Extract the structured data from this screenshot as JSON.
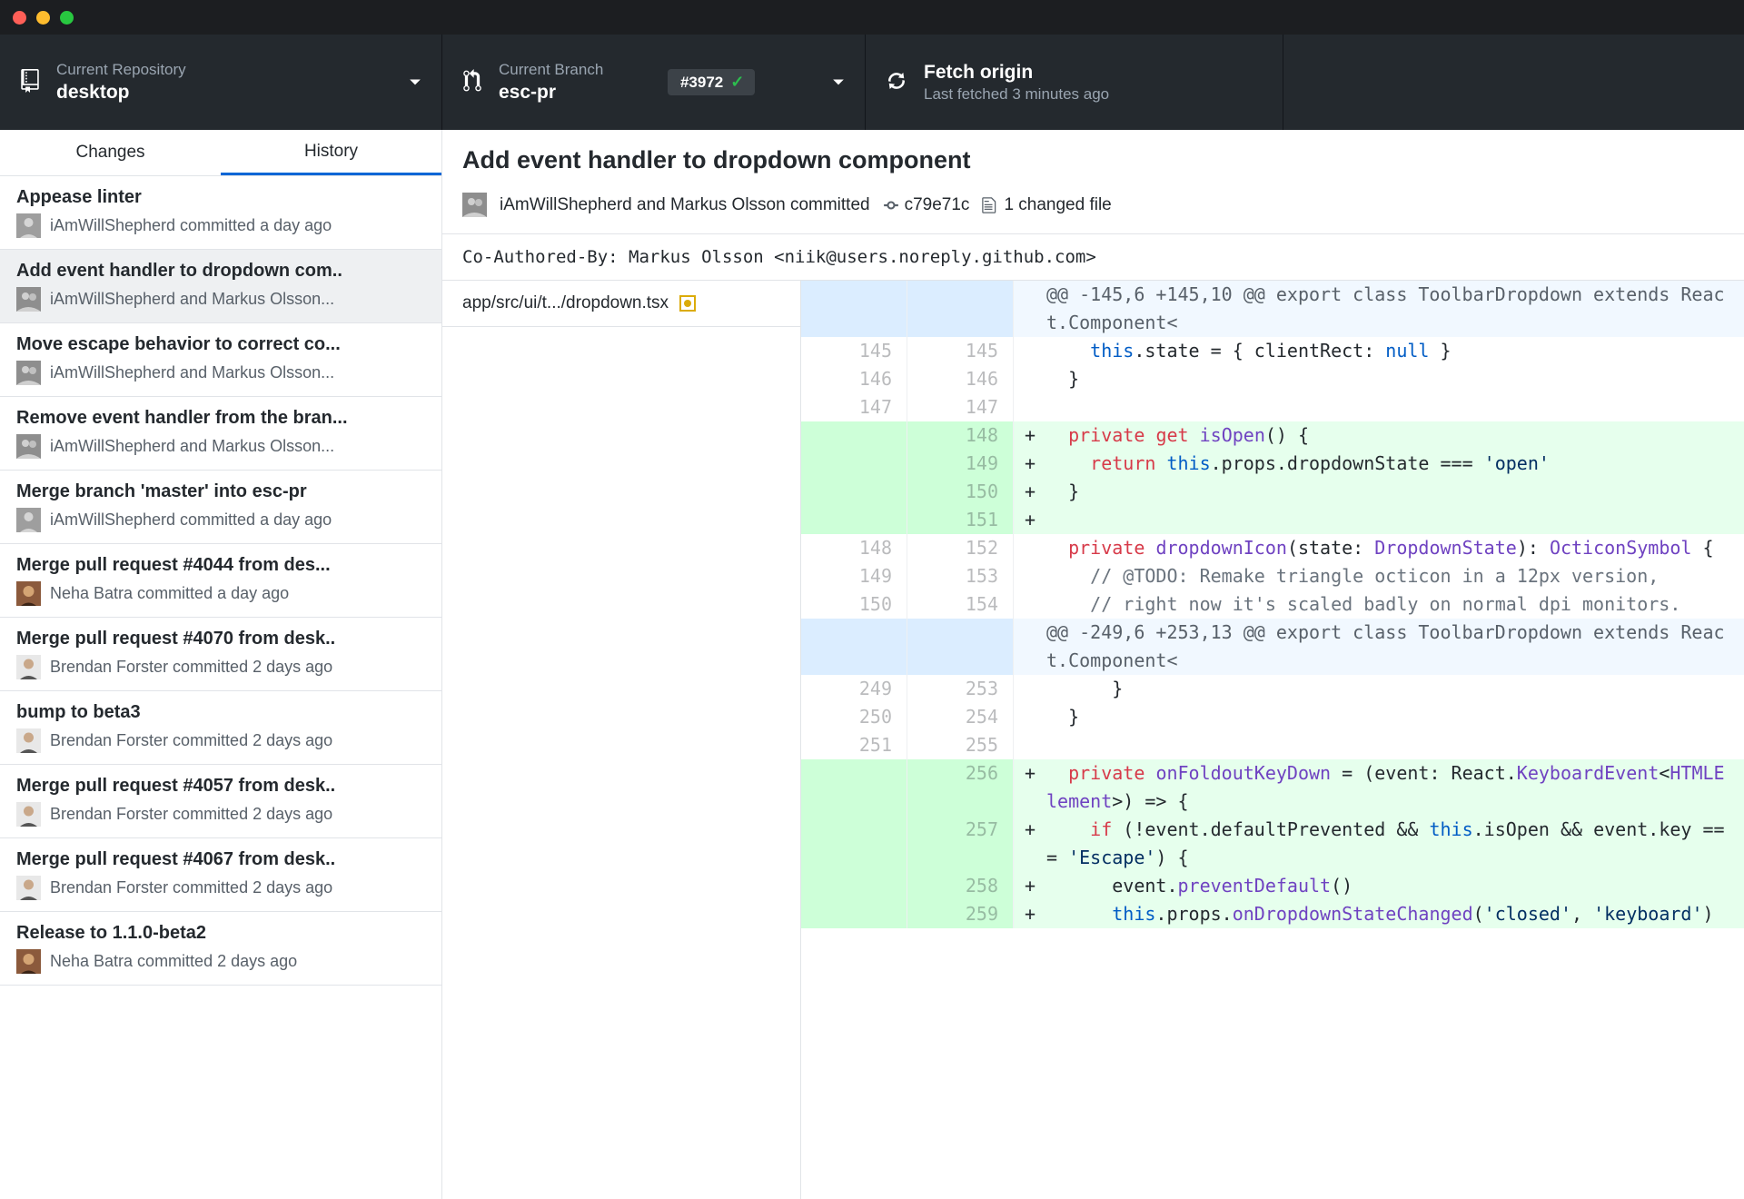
{
  "toolbar": {
    "repo": {
      "label": "Current Repository",
      "value": "desktop"
    },
    "branch": {
      "label": "Current Branch",
      "value": "esc-pr",
      "pr_number": "#3972"
    },
    "fetch": {
      "label": "Fetch origin",
      "sub": "Last fetched 3 minutes ago"
    }
  },
  "tabs": {
    "changes": "Changes",
    "history": "History"
  },
  "commits": [
    {
      "title": "Appease linter",
      "author": "iAmWillShepherd committed a day ago",
      "avatar": "will",
      "selected": false
    },
    {
      "title": "Add event handler to dropdown com..",
      "author": "iAmWillShepherd and Markus Olsson...",
      "avatar": "pair",
      "selected": true
    },
    {
      "title": "Move escape behavior to correct co...",
      "author": "iAmWillShepherd and Markus Olsson...",
      "avatar": "pair",
      "selected": false
    },
    {
      "title": "Remove event handler from the bran...",
      "author": "iAmWillShepherd and Markus Olsson...",
      "avatar": "pair",
      "selected": false
    },
    {
      "title": "Merge branch 'master' into esc-pr",
      "author": "iAmWillShepherd committed a day ago",
      "avatar": "will",
      "selected": false
    },
    {
      "title": "Merge pull request #4044 from des...",
      "author": "Neha Batra committed a day ago",
      "avatar": "neha",
      "selected": false
    },
    {
      "title": "Merge pull request #4070 from desk..",
      "author": "Brendan Forster committed 2 days ago",
      "avatar": "brendan",
      "selected": false
    },
    {
      "title": "bump to beta3",
      "author": "Brendan Forster committed 2 days ago",
      "avatar": "brendan",
      "selected": false
    },
    {
      "title": "Merge pull request #4057 from desk..",
      "author": "Brendan Forster committed 2 days ago",
      "avatar": "brendan",
      "selected": false
    },
    {
      "title": "Merge pull request #4067 from desk..",
      "author": "Brendan Forster committed 2 days ago",
      "avatar": "brendan",
      "selected": false
    },
    {
      "title": "Release to 1.1.0-beta2",
      "author": "Neha Batra committed 2 days ago",
      "avatar": "neha",
      "selected": false
    }
  ],
  "commit_detail": {
    "title": "Add event handler to dropdown component",
    "authors": "iAmWillShepherd and Markus Olsson committed",
    "hash": "c79e71c",
    "files_changed": "1 changed file",
    "description": "Co-Authored-By: Markus Olsson <niik@users.noreply.github.com>",
    "file_path": "app/src/ui/t.../dropdown.tsx"
  },
  "diff": [
    {
      "type": "hunk",
      "old": "",
      "new": "",
      "sign": "",
      "tokens": [
        [
          "",
          "@@ -145,6 +145,10 @@ export class ToolbarDropdown extends React.Component<"
        ]
      ]
    },
    {
      "type": "context",
      "old": "145",
      "new": "145",
      "sign": "",
      "tokens": [
        [
          "",
          "    "
        ],
        [
          "this",
          "this"
        ],
        [
          "",
          ".state = { clientRect: "
        ],
        [
          "null",
          "null"
        ],
        [
          "",
          " }"
        ]
      ]
    },
    {
      "type": "context",
      "old": "146",
      "new": "146",
      "sign": "",
      "tokens": [
        [
          "",
          "  }"
        ]
      ]
    },
    {
      "type": "context",
      "old": "147",
      "new": "147",
      "sign": "",
      "tokens": [
        [
          "",
          ""
        ]
      ]
    },
    {
      "type": "add",
      "old": "",
      "new": "148",
      "sign": "+",
      "tokens": [
        [
          "",
          "  "
        ],
        [
          "kw",
          "private"
        ],
        [
          "",
          " "
        ],
        [
          "kw",
          "get"
        ],
        [
          "",
          " "
        ],
        [
          "fn",
          "isOpen"
        ],
        [
          "",
          "() {"
        ]
      ]
    },
    {
      "type": "add",
      "old": "",
      "new": "149",
      "sign": "+",
      "tokens": [
        [
          "",
          "    "
        ],
        [
          "kw",
          "return"
        ],
        [
          "",
          " "
        ],
        [
          "this",
          "this"
        ],
        [
          "",
          ".props.dropdownState === "
        ],
        [
          "str",
          "'open'"
        ]
      ]
    },
    {
      "type": "add",
      "old": "",
      "new": "150",
      "sign": "+",
      "tokens": [
        [
          "",
          "  }"
        ]
      ]
    },
    {
      "type": "add",
      "old": "",
      "new": "151",
      "sign": "+",
      "tokens": [
        [
          "",
          ""
        ]
      ]
    },
    {
      "type": "context",
      "old": "148",
      "new": "152",
      "sign": "",
      "tokens": [
        [
          "",
          "  "
        ],
        [
          "kw",
          "private"
        ],
        [
          "",
          " "
        ],
        [
          "fn",
          "dropdownIcon"
        ],
        [
          "",
          "(state: "
        ],
        [
          "type",
          "DropdownState"
        ],
        [
          "",
          "): "
        ],
        [
          "type",
          "OcticonSymbol"
        ],
        [
          "",
          " {"
        ]
      ]
    },
    {
      "type": "context",
      "old": "149",
      "new": "153",
      "sign": "",
      "tokens": [
        [
          "",
          "    "
        ],
        [
          "comment",
          "// @TODO: Remake triangle octicon in a 12px version,"
        ]
      ]
    },
    {
      "type": "context",
      "old": "150",
      "new": "154",
      "sign": "",
      "tokens": [
        [
          "",
          "    "
        ],
        [
          "comment",
          "// right now it's scaled badly on normal dpi monitors."
        ]
      ]
    },
    {
      "type": "hunk",
      "old": "",
      "new": "",
      "sign": "",
      "tokens": [
        [
          "",
          "@@ -249,6 +253,13 @@ export class ToolbarDropdown extends React.Component<"
        ]
      ]
    },
    {
      "type": "context",
      "old": "249",
      "new": "253",
      "sign": "",
      "tokens": [
        [
          "",
          "      }"
        ]
      ]
    },
    {
      "type": "context",
      "old": "250",
      "new": "254",
      "sign": "",
      "tokens": [
        [
          "",
          "  }"
        ]
      ]
    },
    {
      "type": "context",
      "old": "251",
      "new": "255",
      "sign": "",
      "tokens": [
        [
          "",
          ""
        ]
      ]
    },
    {
      "type": "add",
      "old": "",
      "new": "256",
      "sign": "+",
      "tokens": [
        [
          "",
          "  "
        ],
        [
          "kw",
          "private"
        ],
        [
          "",
          " "
        ],
        [
          "fn",
          "onFoldoutKeyDown"
        ],
        [
          "",
          " = (event: React."
        ],
        [
          "type",
          "KeyboardEvent"
        ],
        [
          "",
          "<"
        ],
        [
          "type",
          "HTMLElement"
        ],
        [
          "",
          ">) => {"
        ]
      ]
    },
    {
      "type": "add",
      "old": "",
      "new": "257",
      "sign": "+",
      "tokens": [
        [
          "",
          "    "
        ],
        [
          "kw",
          "if"
        ],
        [
          "",
          " (!event.defaultPrevented && "
        ],
        [
          "this",
          "this"
        ],
        [
          "",
          ".isOpen && event.key === "
        ],
        [
          "str",
          "'Escape'"
        ],
        [
          "",
          ") {"
        ]
      ]
    },
    {
      "type": "add",
      "old": "",
      "new": "258",
      "sign": "+",
      "tokens": [
        [
          "",
          "      event."
        ],
        [
          "fn",
          "preventDefault"
        ],
        [
          "",
          "()"
        ]
      ]
    },
    {
      "type": "add",
      "old": "",
      "new": "259",
      "sign": "+",
      "tokens": [
        [
          "",
          "      "
        ],
        [
          "this",
          "this"
        ],
        [
          "",
          ".props."
        ],
        [
          "fn",
          "onDropdownStateChanged"
        ],
        [
          "",
          "("
        ],
        [
          "str",
          "'closed'"
        ],
        [
          "",
          ", "
        ],
        [
          "str",
          "'keyboard'"
        ],
        [
          "",
          ")"
        ]
      ]
    }
  ]
}
